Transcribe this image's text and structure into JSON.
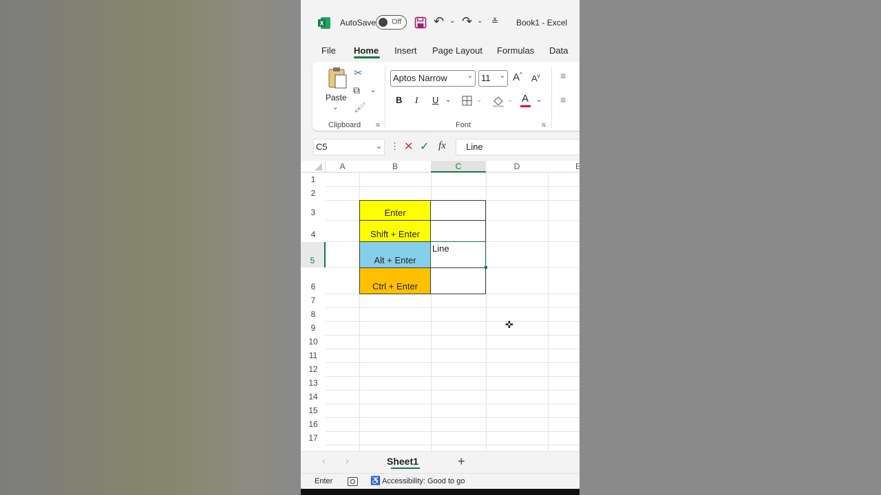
{
  "titlebar": {
    "autosave_label": "AutoSave",
    "autosave_state": "Off",
    "title": "Book1  -  Excel",
    "icons": [
      "excel-logo-icon",
      "save-icon",
      "undo-icon",
      "redo-icon",
      "customize-icon"
    ]
  },
  "tabs": [
    "File",
    "Home",
    "Insert",
    "Page Layout",
    "Formulas",
    "Data"
  ],
  "active_tab": "Home",
  "ribbon": {
    "clipboard": {
      "paste_label": "Paste",
      "group_label": "Clipboard"
    },
    "font": {
      "font_name": "Aptos Narrow",
      "font_size": "11",
      "bold": "B",
      "italic": "I",
      "underline": "U",
      "group_label": "Font",
      "font_color": "#e81123"
    }
  },
  "formula_bar": {
    "name_box": "C5",
    "fx": "fx",
    "value": "Line"
  },
  "columns": [
    "A",
    "B",
    "C",
    "D",
    "E"
  ],
  "selected_column": "C",
  "rows": [
    "1",
    "2",
    "3",
    "4",
    "5",
    "6",
    "7",
    "8",
    "9",
    "10",
    "11",
    "12",
    "13",
    "14",
    "15",
    "16",
    "17"
  ],
  "selected_row": "5",
  "cells": {
    "B3": {
      "text": "Enter",
      "fill": "#ffff00"
    },
    "B4": {
      "text": "Shift + Enter",
      "fill": "#ffff00"
    },
    "B5": {
      "text": "Alt + Enter",
      "fill": "#87ceeb"
    },
    "B6": {
      "text": "Ctrl + Enter",
      "fill": "#ffc000"
    },
    "C5": {
      "text": "Line"
    }
  },
  "sheet_tabs": {
    "active": "Sheet1",
    "add": "+"
  },
  "status": {
    "mode": "Enter",
    "accessibility": "Accessibility: Good to go"
  },
  "colors": {
    "accent": "#107c41"
  }
}
